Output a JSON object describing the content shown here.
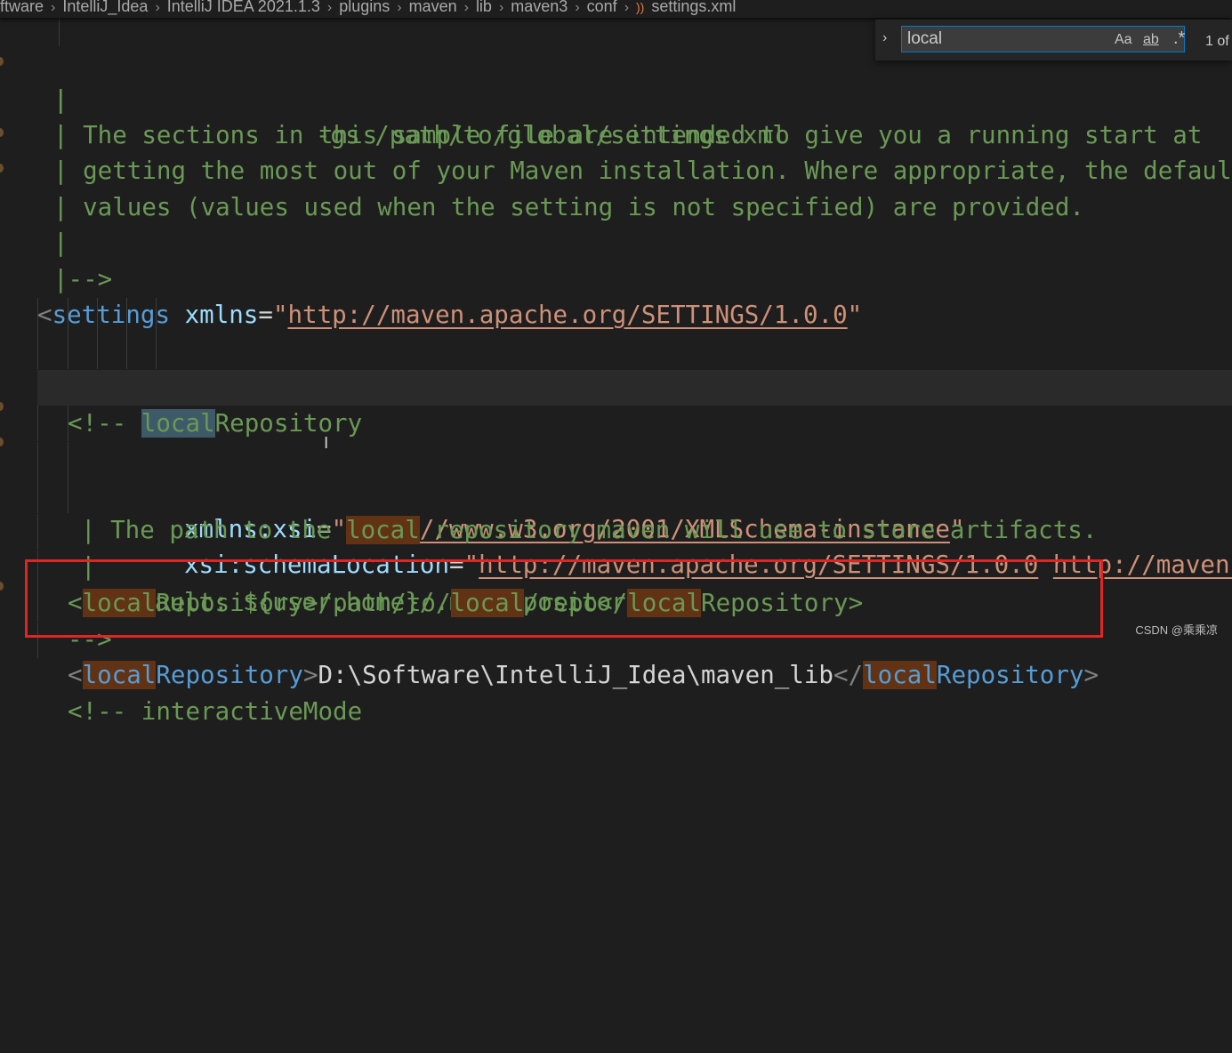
{
  "breadcrumb": {
    "items": [
      "ftware",
      "IntelliJ_Idea",
      "IntelliJ IDEA 2021.1.3",
      "plugins",
      "maven",
      "lib",
      "maven3",
      "conf"
    ],
    "file": "settings.xml"
  },
  "find_widget": {
    "query": "local",
    "case_label": "Aa",
    "word_label": "ab",
    "regex_label": ".*",
    "match_count": "1 of"
  },
  "code": {
    "l1": "-gs /path/to/global/settings.xml",
    "l2_bar": "|",
    "l3": "| The sections in this sample file are intended to give you a running start at",
    "l4": "| getting the most out of your Maven installation. Where appropriate, the default",
    "l5": "| values (values used when the setting is not specified) are provided.",
    "l6_bar": "|",
    "l7": "|-->",
    "settings_tag": "settings",
    "xmlns_attr": "xmlns",
    "xmlns_val": "http://maven.apache.org/SETTINGS/1.0.0",
    "xsi_attr": "xmlns:xsi",
    "xsi_val": "http://www.w3.org/2001/XMLSchema-instance",
    "schema_attr": "xsi:schemaLocation",
    "schema_val1": "http://maven.apache.org/SETTINGS/1.0.0",
    "schema_val2": "http://maven.",
    "comment_open": "<!-- ",
    "local_word": "local",
    "repository_word": "Repository",
    "path_line_a": "| The path to the ",
    "path_line_b": " repository maven will use to store artifacts.",
    "bar_line": "|",
    "default_line": "| Default: ${user.home}/.m2/repository",
    "repo_text_a": "/path/to/",
    "repo_text_b": "/repo",
    "comment_close": "-->",
    "user_repo_path": "D:\\Software\\IntelliJ_Idea\\maven_lib",
    "next_comment": "<!-- interactiveMode"
  },
  "watermark": "CSDN @乘乘凉",
  "colors": {
    "comment": "#6a9955",
    "tag": "#569cd6",
    "attribute": "#9cdcfe",
    "string": "#ce9178",
    "match_highlight": "#613214",
    "annotation_box": "#e02525"
  }
}
